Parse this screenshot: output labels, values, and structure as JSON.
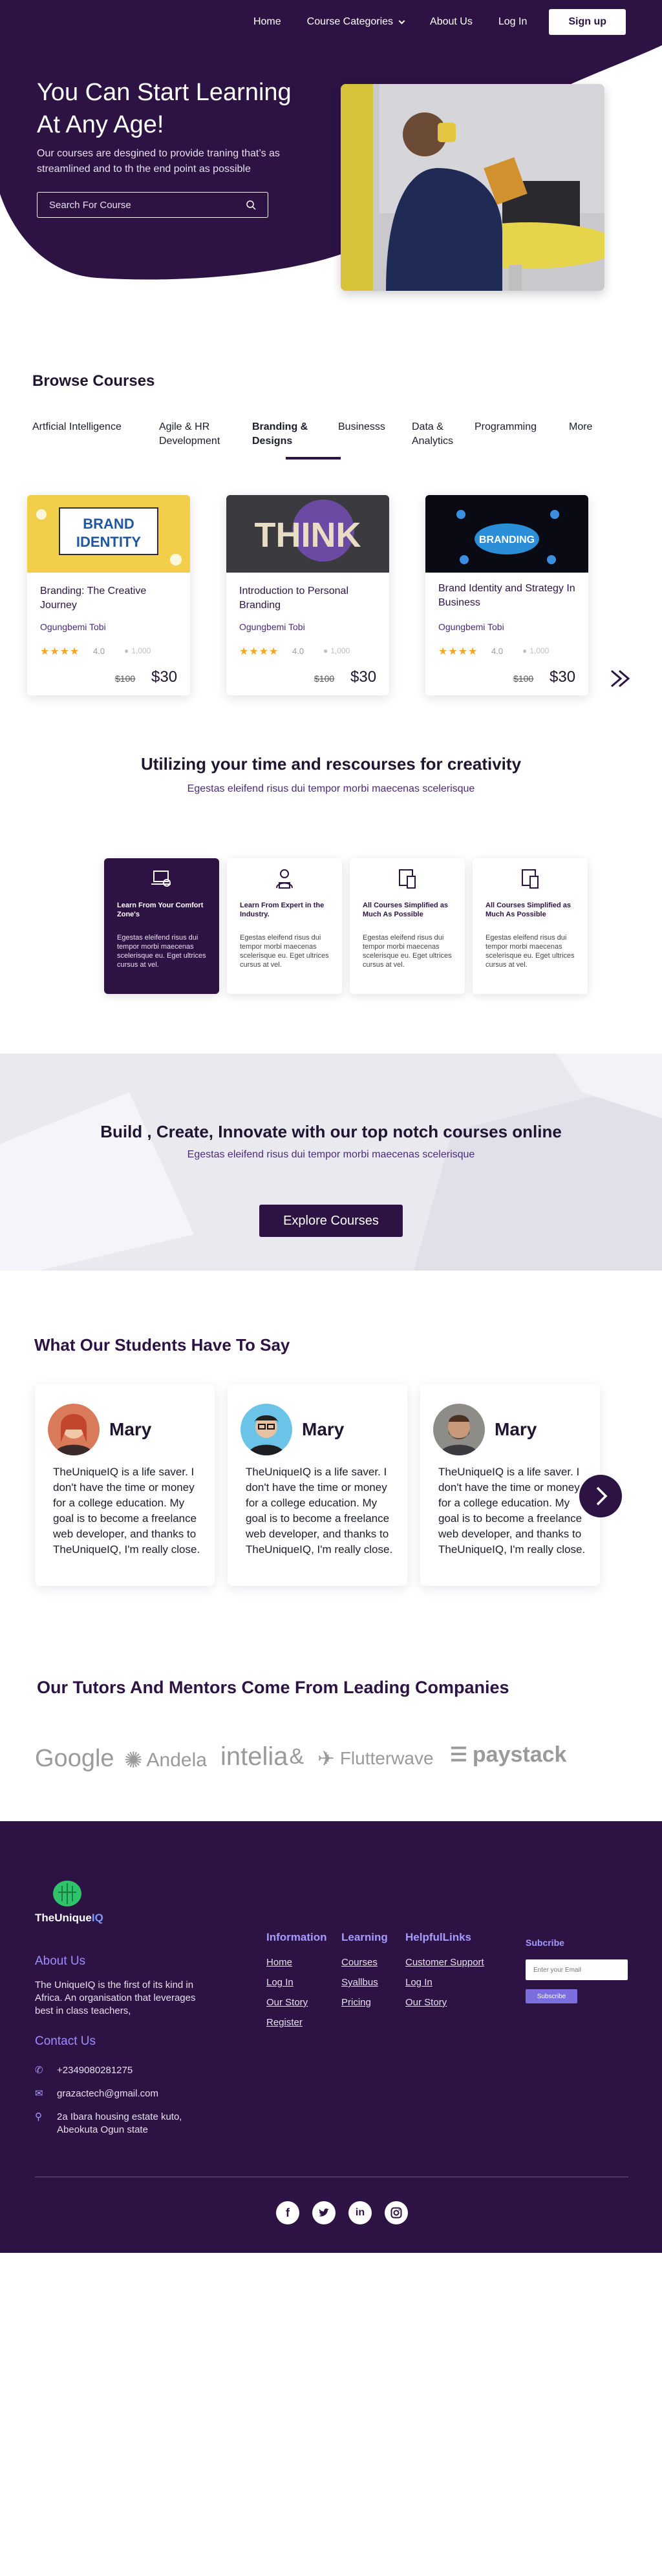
{
  "nav": {
    "home": "Home",
    "course_categories": "Course Categories",
    "about_us": "About Us",
    "login": "Log In",
    "signup": "Sign up"
  },
  "hero": {
    "title": "You Can Start Learning At Any Age!",
    "subtitle": "Our courses are desgined  to provide traning that’s as streamlined and to th the end point as possible",
    "search_placeholder": "Search For Course"
  },
  "browse": {
    "title": "Browse Courses",
    "tabs": [
      {
        "label": "Artficial Intelligence"
      },
      {
        "label": "Agile & HR Development"
      },
      {
        "label": "Branding & Designs"
      },
      {
        "label": "Businesss"
      },
      {
        "label": "Data & Analytics"
      },
      {
        "label": "Programming"
      },
      {
        "label": "More"
      }
    ],
    "active_tab": "Branding & Designs",
    "courses": [
      {
        "title": "Branding: The Creative Journey",
        "author": "Ogungbemi Tobi",
        "stars": "★★★★",
        "rating": "4.0",
        "views": "1,000",
        "old_price": "$100",
        "price": "$30",
        "thumb_text": "BRAND IDENTITY"
      },
      {
        "title": "Introduction to Personal Branding",
        "author": "Ogungbemi Tobi",
        "stars": "★★★★",
        "rating": "4.0",
        "views": "1,000",
        "old_price": "$100",
        "price": "$30",
        "thumb_text": "THINK"
      },
      {
        "title": "Brand Identity and Strategy In Business",
        "author": "Ogungbemi Tobi",
        "stars": "★★★★",
        "rating": "4.0",
        "views": "1,000",
        "old_price": "$100",
        "price": "$30",
        "thumb_text": "BRANDING"
      }
    ]
  },
  "utilize": {
    "title": "Utilizing your time and rescourses for creativity",
    "subtitle": "Egestas eleifend risus dui tempor morbi maecenas scelerisque",
    "features": [
      {
        "title": "Learn From Your Comfort Zone's",
        "text": "Egestas eleifend risus dui tempor morbi maecenas scelerisque eu. Eget ultrices cursus at vel.",
        "icon": "laptop-user-icon"
      },
      {
        "title": "Learn From Expert in the Industry.",
        "text": "Egestas eleifend risus dui tempor morbi maecenas scelerisque eu. Eget ultrices cursus at vel.",
        "icon": "teacher-icon"
      },
      {
        "title": "All Courses Simplified as Much As Possible",
        "text": "Egestas eleifend risus dui tempor morbi maecenas scelerisque eu. Eget ultrices cursus at vel.",
        "icon": "devices-icon"
      },
      {
        "title": "All Courses Simplified as Much As Possible",
        "text": "Egestas eleifend risus dui tempor morbi maecenas scelerisque eu. Eget ultrices cursus at vel.",
        "icon": "devices-icon"
      }
    ]
  },
  "build": {
    "title": "Build , Create, Innovate with our top notch courses online",
    "subtitle": "Egestas eleifend risus dui tempor morbi maecenas scelerisque",
    "button": "Explore Courses"
  },
  "testimonials": {
    "title": "What Our Students Have To Say",
    "items": [
      {
        "name": "Mary",
        "quote": "TheUniqueIQ is a life saver. I don't have the time or money for a college education. My goal is to become a freelance web developer, and thanks to TheUniqueIQ, I'm really close."
      },
      {
        "name": "Mary",
        "quote": "TheUniqueIQ is a life saver. I don't have the time or money for a college education. My goal is to become a freelance web developer, and thanks to TheUniqueIQ, I'm really close."
      },
      {
        "name": "Mary",
        "quote": "TheUniqueIQ is a life saver. I don't have the time or money for a college education. My goal is to become a freelance web developer, and thanks to TheUniqueIQ, I'm really close."
      }
    ]
  },
  "companies": {
    "title": "Our Tutors And Mentors Come From Leading Companies",
    "logos": [
      "Google",
      "Andela",
      "intelia",
      "Flutterwave",
      "paystack"
    ]
  },
  "footer": {
    "brand_prefix": "TheUnique",
    "brand_suffix": "IQ",
    "about_title": "About Us",
    "about_text": "The UniqueIQ is the first of its kind in Africa. An organisation that leverages best in class teachers,",
    "contact_title": "Contact Us",
    "phone": "+2349080281275",
    "email": "grazactech@gmail.com",
    "address": "2a Ibara housing estate kuto, Abeokuta Ogun state",
    "columns": [
      {
        "title": "Information",
        "links": [
          "Home",
          "Log In",
          "Our Story",
          "Register"
        ]
      },
      {
        "title": "Learning",
        "links": [
          "Courses",
          "Syallbus",
          "Pricing"
        ]
      },
      {
        "title": "HelpfulLinks",
        "links": [
          "Customer Support",
          "Log In",
          "Our Story"
        ]
      }
    ],
    "subscribe_title": "Subcribe",
    "subscribe_placeholder": "Enter your Email",
    "subscribe_button": "Subscribe",
    "social": [
      "facebook-icon",
      "twitter-icon",
      "linkedin-icon",
      "instagram-icon"
    ]
  },
  "colors": {
    "primary": "#2d1343",
    "star": "#f5a623",
    "accent_link": "#a59bff"
  }
}
